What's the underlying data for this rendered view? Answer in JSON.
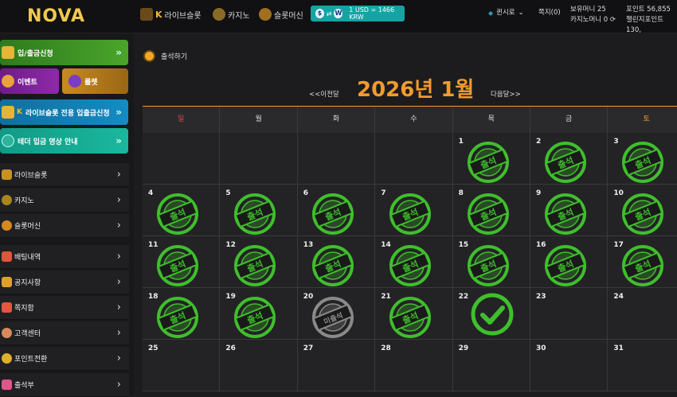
{
  "header": {
    "logo_text": "NOVA",
    "nav": [
      {
        "label": "라이브슬롯",
        "icon": "live-slot-icon"
      },
      {
        "label": "카지노",
        "icon": "casino-icon"
      },
      {
        "label": "슬롯머신",
        "icon": "slot-machine-icon"
      }
    ],
    "rate": {
      "from": "$",
      "to": "W",
      "label": "1 USD = 1466 KRW"
    },
    "user": {
      "name": "퀸시로",
      "messages": "쪽지(0)"
    },
    "wallet": {
      "holding": "보유머니 25",
      "casino": "카지노머니 0",
      "points": "포인트 56,855",
      "challenge": "챌린지포인트 130,"
    }
  },
  "sidebar": {
    "deposit": "입/출금신청",
    "event": "이벤트",
    "roulette": "룰렛",
    "live_slot_deposit": "라이브슬롯 전용 입출금신청",
    "tether": "테더 입금 영상 안내",
    "menu": [
      {
        "label": "라이브슬롯",
        "icon": "live-slot-icon"
      },
      {
        "label": "카지노",
        "icon": "casino-icon"
      },
      {
        "label": "슬롯머신",
        "icon": "slot-machine-icon"
      },
      {
        "label": "배팅내역",
        "icon": "betting-history-icon"
      },
      {
        "label": "공지사항",
        "icon": "megaphone-icon"
      },
      {
        "label": "쪽지함",
        "icon": "envelope-icon"
      },
      {
        "label": "고객센터",
        "icon": "support-icon"
      },
      {
        "label": "포인트전환",
        "icon": "point-exchange-icon"
      },
      {
        "label": "출석부",
        "icon": "attendance-icon"
      }
    ]
  },
  "main": {
    "section_label": "출석하기",
    "prev": "<<이전달",
    "next": "다음달>>",
    "title": "2026년 1월",
    "weekdays": [
      "일",
      "월",
      "화",
      "수",
      "목",
      "금",
      "토"
    ],
    "stamp_text": "출석",
    "missed_text": "미출석",
    "days": [
      {
        "day": "",
        "status": ""
      },
      {
        "day": "",
        "status": ""
      },
      {
        "day": "",
        "status": ""
      },
      {
        "day": "",
        "status": ""
      },
      {
        "day": "1",
        "status": "present"
      },
      {
        "day": "2",
        "status": "present"
      },
      {
        "day": "3",
        "status": "present"
      },
      {
        "day": "4",
        "status": "present"
      },
      {
        "day": "5",
        "status": "present"
      },
      {
        "day": "6",
        "status": "present"
      },
      {
        "day": "7",
        "status": "present"
      },
      {
        "day": "8",
        "status": "present"
      },
      {
        "day": "9",
        "status": "present"
      },
      {
        "day": "10",
        "status": "present"
      },
      {
        "day": "11",
        "status": "present"
      },
      {
        "day": "12",
        "status": "present"
      },
      {
        "day": "13",
        "status": "present"
      },
      {
        "day": "14",
        "status": "present"
      },
      {
        "day": "15",
        "status": "present"
      },
      {
        "day": "16",
        "status": "present"
      },
      {
        "day": "17",
        "status": "present"
      },
      {
        "day": "18",
        "status": "present"
      },
      {
        "day": "19",
        "status": "present"
      },
      {
        "day": "20",
        "status": "missed"
      },
      {
        "day": "21",
        "status": "present"
      },
      {
        "day": "22",
        "status": "today"
      },
      {
        "day": "23",
        "status": ""
      },
      {
        "day": "24",
        "status": ""
      },
      {
        "day": "25",
        "status": ""
      },
      {
        "day": "26",
        "status": ""
      },
      {
        "day": "27",
        "status": ""
      },
      {
        "day": "28",
        "status": ""
      },
      {
        "day": "29",
        "status": ""
      },
      {
        "day": "30",
        "status": ""
      },
      {
        "day": "31",
        "status": ""
      }
    ],
    "colors": {
      "accent": "#f29a2e",
      "sunday": "#e04848",
      "saturday": "#f29a2e",
      "stamp": "#3fbf2c",
      "missed": "#8a8a8a"
    }
  }
}
